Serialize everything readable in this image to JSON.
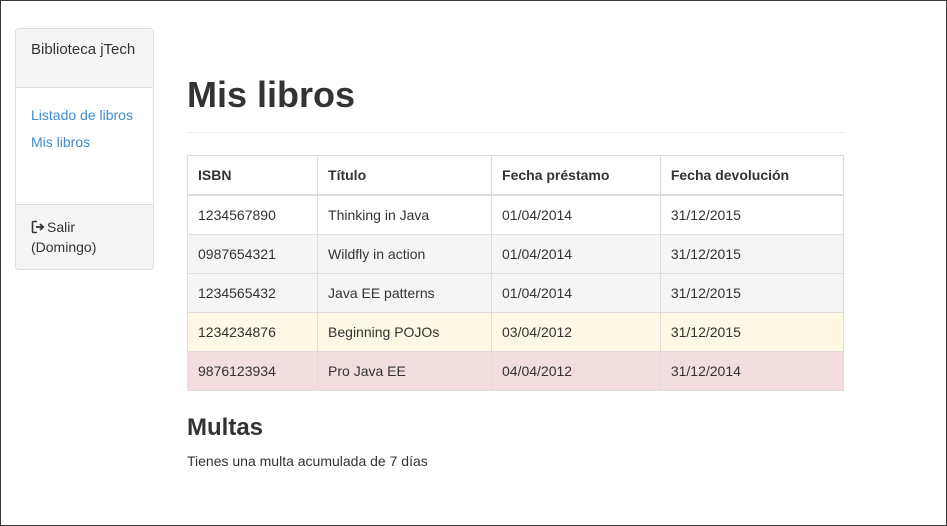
{
  "sidebar": {
    "brand": "Biblioteca jTech",
    "nav": [
      {
        "label": "Listado de libros"
      },
      {
        "label": "Mis libros"
      }
    ],
    "logout": {
      "icon": "logout-icon",
      "label": "Salir (Domingo)"
    }
  },
  "main": {
    "title": "Mis libros",
    "table": {
      "headers": [
        "ISBN",
        "Título",
        "Fecha préstamo",
        "Fecha devolución"
      ],
      "rows": [
        {
          "isbn": "1234567890",
          "title": "Thinking in Java",
          "loan_date": "01/04/2014",
          "return_date": "31/12/2015"
        },
        {
          "isbn": "0987654321",
          "title": "Wildfly in action",
          "loan_date": "01/04/2014",
          "return_date": "31/12/2015"
        },
        {
          "isbn": "1234565432",
          "title": "Java EE patterns",
          "loan_date": "01/04/2014",
          "return_date": "31/12/2015"
        },
        {
          "isbn": "1234234876",
          "title": "Beginning POJOs",
          "loan_date": "03/04/2012",
          "return_date": "31/12/2015"
        },
        {
          "isbn": "9876123934",
          "title": "Pro Java EE",
          "loan_date": "04/04/2012",
          "return_date": "31/12/2014"
        }
      ]
    },
    "fines": {
      "title": "Multas",
      "text": "Tienes una multa acumulada de 7 días"
    }
  },
  "colors": {
    "link": "#428bca",
    "row_striped": "#f5f5f5",
    "row_warning": "#fcf8e3",
    "row_danger": "#f2dede"
  }
}
